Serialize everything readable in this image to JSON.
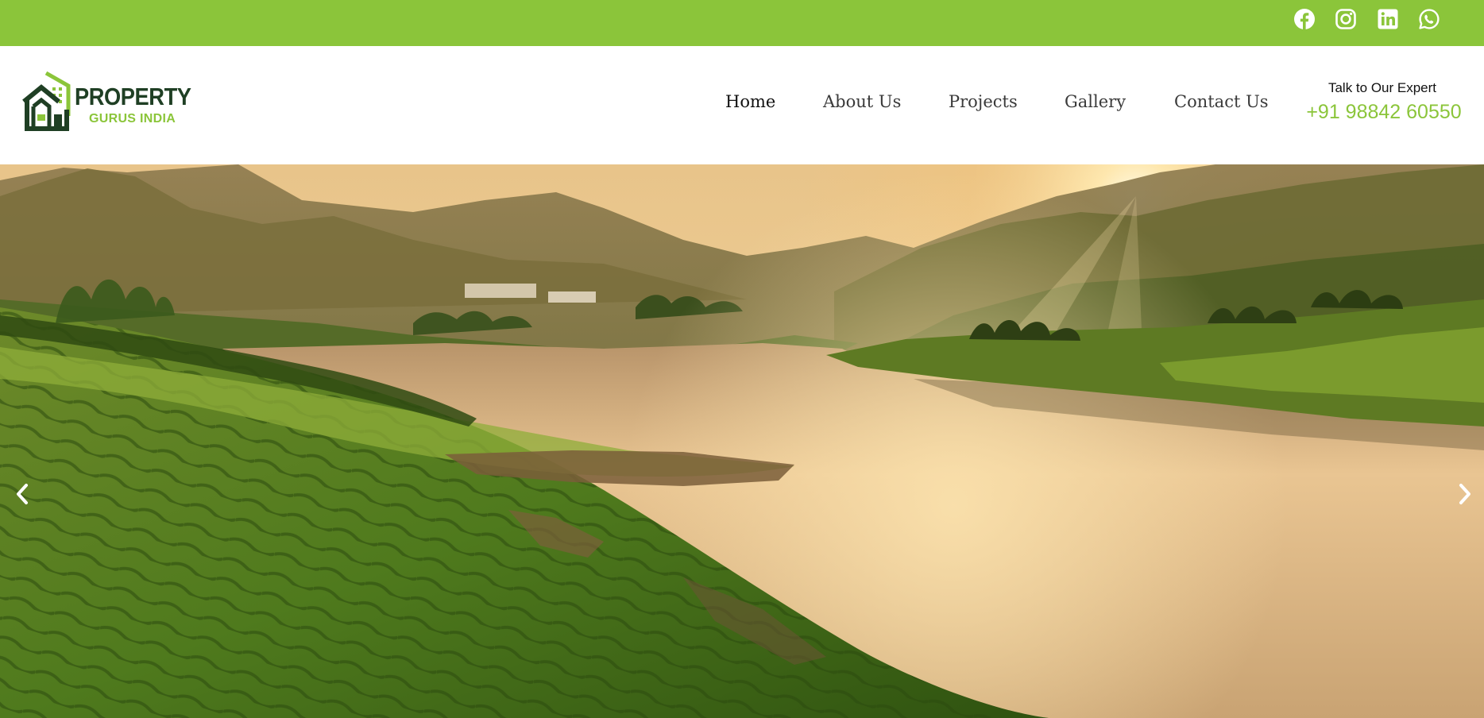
{
  "topbar": {
    "background_color": "#8bc53a",
    "social_icons": [
      "facebook-icon",
      "instagram-icon",
      "linkedin-icon",
      "whatsapp-icon"
    ]
  },
  "header": {
    "logo": {
      "line1": "PROPERTY",
      "line2": "GURUS INDIA",
      "primary_color": "#1f3f24",
      "accent_color": "#8bc53a"
    },
    "nav": [
      {
        "label": "Home",
        "active": true
      },
      {
        "label": "About Us",
        "active": false
      },
      {
        "label": "Projects",
        "active": false
      },
      {
        "label": "Gallery",
        "active": false
      },
      {
        "label": "Contact Us",
        "active": false
      }
    ],
    "expert": {
      "label": "Talk to Our Expert",
      "phone": "+91 98842 60550"
    }
  },
  "hero": {
    "image": "sunset over lake with tea plantation hills",
    "prev_icon": "chevron-left-icon",
    "next_icon": "chevron-right-icon"
  }
}
